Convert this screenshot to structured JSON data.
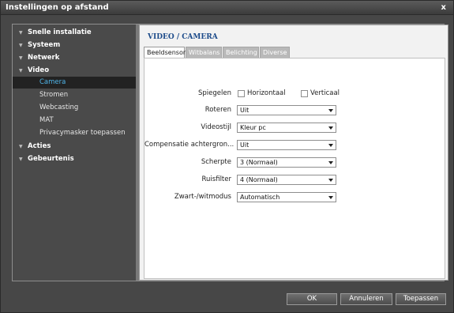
{
  "window": {
    "title": "Instellingen op afstand",
    "close": "x"
  },
  "sidebar": {
    "items": [
      {
        "label": "Snelle installatie"
      },
      {
        "label": "Systeem"
      },
      {
        "label": "Netwerk"
      },
      {
        "label": "Video"
      },
      {
        "label": "Camera"
      },
      {
        "label": "Stromen"
      },
      {
        "label": "Webcasting"
      },
      {
        "label": "MAT"
      },
      {
        "label": "Privacymasker toepassen"
      },
      {
        "label": "Acties"
      },
      {
        "label": "Gebeurtenis"
      }
    ]
  },
  "main": {
    "title": "VIDEO / CAMERA",
    "tabs": [
      {
        "label": "Beeldsensor"
      },
      {
        "label": "Witbalans"
      },
      {
        "label": "Belichting"
      },
      {
        "label": "Diverse"
      }
    ],
    "mirror": {
      "label": "Spiegelen",
      "horizontal": "Horizontaal",
      "vertical": "Verticaal"
    },
    "fields": [
      {
        "label": "Roteren",
        "value": "Uit"
      },
      {
        "label": "Videostijl",
        "value": "Kleur pc"
      },
      {
        "label": "Compensatie achtergron...",
        "value": "Uit"
      },
      {
        "label": "Scherpte",
        "value": "3 (Normaal)"
      },
      {
        "label": "Ruisfilter",
        "value": "4 (Normaal)"
      },
      {
        "label": "Zwart-/witmodus",
        "value": "Automatisch"
      }
    ]
  },
  "footer": {
    "ok": "OK",
    "cancel": "Annuleren",
    "apply": "Toepassen"
  }
}
